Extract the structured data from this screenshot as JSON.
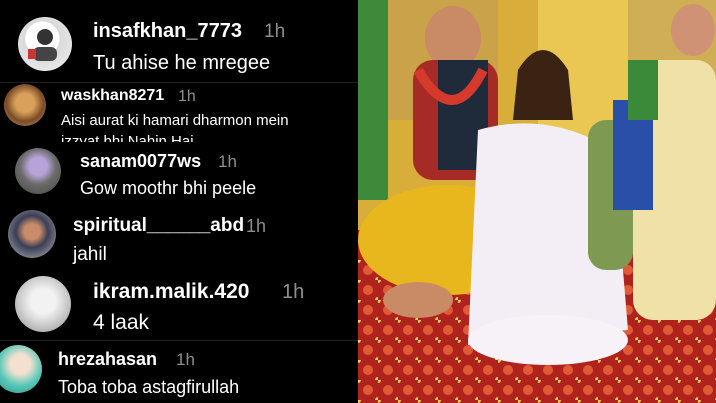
{
  "comments": [
    {
      "username": "insafkhan_7773",
      "time": "1h",
      "text": "Tu ahise he mregee",
      "avatar_icon": "user-avatar-icon"
    },
    {
      "username": "waskhan8271",
      "time": "1h",
      "text": "Aisi aurat ki hamari dharmon mein",
      "text2": "izzyat bhi Nahin Hai",
      "avatar_icon": "user-avatar-icon"
    },
    {
      "username": "sanam0077ws",
      "time": "1h",
      "text": "Gow moothr bhi peele",
      "avatar_icon": "user-avatar-icon"
    },
    {
      "username": "spiritual______abd",
      "time": "1h",
      "text": "jahil",
      "avatar_icon": "user-avatar-icon"
    },
    {
      "username": "ikram.malik.420",
      "time": "1h",
      "text": "4 laak",
      "avatar_icon": "user-avatar-icon"
    },
    {
      "username": "hrezahasan",
      "time": "1h",
      "text": "Toba toba astagfirullah",
      "avatar_icon": "user-avatar-icon"
    }
  ],
  "colors": {
    "background": "#000000",
    "username": "#ffffff",
    "timestamp": "#8e8e8e"
  }
}
